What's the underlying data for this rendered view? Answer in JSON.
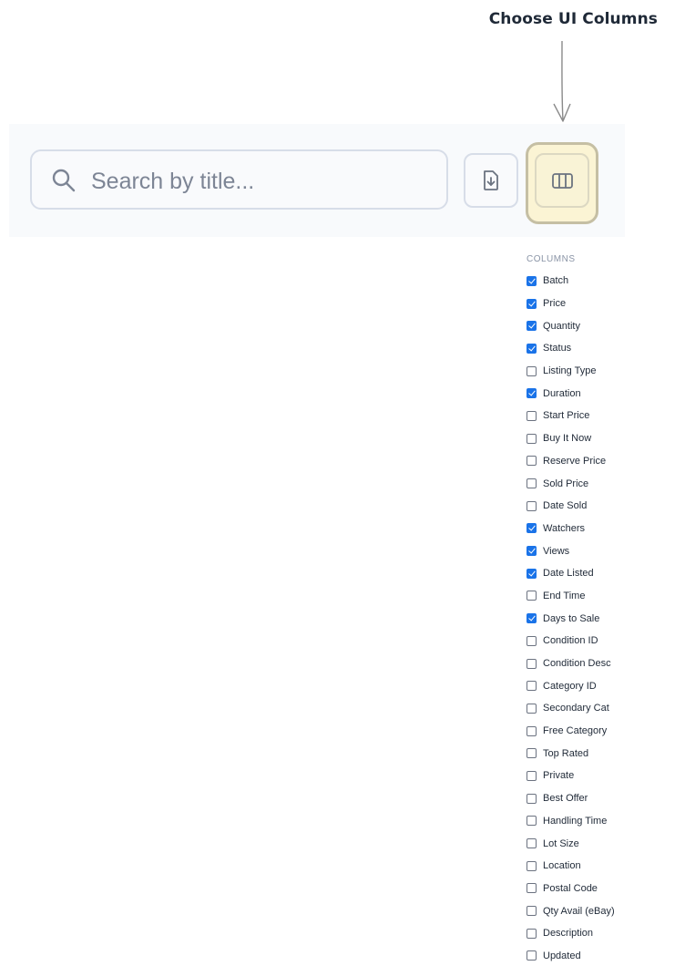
{
  "annotation": {
    "label": "Choose UI Columns"
  },
  "toolbar": {
    "search": {
      "placeholder": "Search by title...",
      "value": "",
      "icon": "search-icon"
    },
    "export_button": {
      "icon": "file-download-icon"
    },
    "columns_button": {
      "icon": "columns-icon",
      "highlighted": true
    }
  },
  "columns_panel": {
    "title": "COLUMNS",
    "options": [
      {
        "label": "Batch",
        "checked": true
      },
      {
        "label": "Price",
        "checked": true
      },
      {
        "label": "Quantity",
        "checked": true
      },
      {
        "label": "Status",
        "checked": true
      },
      {
        "label": "Listing Type",
        "checked": false
      },
      {
        "label": "Duration",
        "checked": true
      },
      {
        "label": "Start Price",
        "checked": false
      },
      {
        "label": "Buy It Now",
        "checked": false
      },
      {
        "label": "Reserve Price",
        "checked": false
      },
      {
        "label": "Sold Price",
        "checked": false
      },
      {
        "label": "Date Sold",
        "checked": false
      },
      {
        "label": "Watchers",
        "checked": true
      },
      {
        "label": "Views",
        "checked": true
      },
      {
        "label": "Date Listed",
        "checked": true
      },
      {
        "label": "End Time",
        "checked": false
      },
      {
        "label": "Days to Sale",
        "checked": true
      },
      {
        "label": "Condition ID",
        "checked": false
      },
      {
        "label": "Condition Desc",
        "checked": false
      },
      {
        "label": "Category ID",
        "checked": false
      },
      {
        "label": "Secondary Cat",
        "checked": false
      },
      {
        "label": "Free Category",
        "checked": false
      },
      {
        "label": "Top Rated",
        "checked": false
      },
      {
        "label": "Private",
        "checked": false
      },
      {
        "label": "Best Offer",
        "checked": false
      },
      {
        "label": "Handling Time",
        "checked": false
      },
      {
        "label": "Lot Size",
        "checked": false
      },
      {
        "label": "Location",
        "checked": false
      },
      {
        "label": "Postal Code",
        "checked": false
      },
      {
        "label": "Qty Avail (eBay)",
        "checked": false
      },
      {
        "label": "Description",
        "checked": false
      },
      {
        "label": "Updated",
        "checked": false
      }
    ]
  },
  "colors": {
    "checkbox_checked": "#1a73e8",
    "highlight_fill": "#fbf4d4",
    "toolbar_bg": "#f8fafc"
  }
}
